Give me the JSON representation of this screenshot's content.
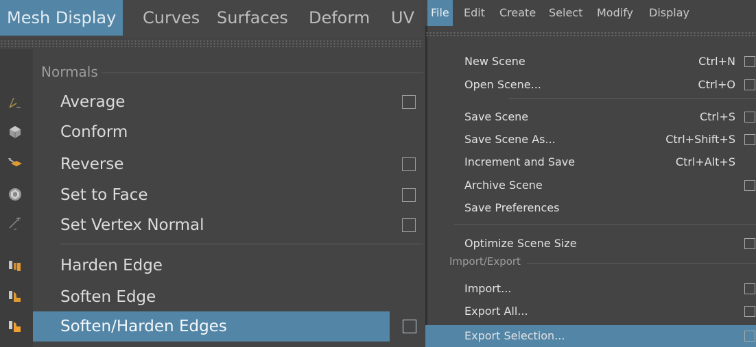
{
  "left_panel": {
    "menubar": [
      "Mesh Display",
      "Curves",
      "Surfaces",
      "Deform",
      "UV"
    ],
    "section_label": "Normals",
    "items": [
      {
        "label": "Average",
        "has_option": true,
        "icon": "average-normals-icon"
      },
      {
        "label": "Conform",
        "has_option": false,
        "icon": "conform-normals-icon"
      },
      {
        "label": "Reverse",
        "has_option": true,
        "icon": "reverse-normals-icon"
      },
      {
        "label": "Set to Face",
        "has_option": true,
        "icon": "set-to-face-icon"
      },
      {
        "label": "Set Vertex Normal",
        "has_option": true,
        "icon": "set-vertex-normal-icon"
      },
      {
        "label": "Harden Edge",
        "has_option": false,
        "icon": "harden-edge-icon"
      },
      {
        "label": "Soften Edge",
        "has_option": false,
        "icon": "soften-edge-icon"
      },
      {
        "label": "Soften/Harden Edges",
        "has_option": true,
        "icon": "soften-harden-edges-icon",
        "highlighted": true
      }
    ]
  },
  "right_panel": {
    "menubar": [
      "File",
      "Edit",
      "Create",
      "Select",
      "Modify",
      "Display"
    ],
    "items": [
      {
        "label": "New Scene",
        "shortcut": "Ctrl+N"
      },
      {
        "label": "Open Scene...",
        "shortcut": "Ctrl+O"
      },
      {
        "label": "Save Scene",
        "shortcut": "Ctrl+S"
      },
      {
        "label": "Save Scene As...",
        "shortcut": "Ctrl+Shift+S"
      },
      {
        "label": "Increment and Save",
        "shortcut": "Ctrl+Alt+S"
      },
      {
        "label": "Archive Scene",
        "shortcut": ""
      },
      {
        "label": "Save Preferences",
        "shortcut": ""
      },
      {
        "label": "Optimize Scene Size",
        "shortcut": ""
      },
      {
        "label": "Import...",
        "shortcut": ""
      },
      {
        "label": "Export All...",
        "shortcut": ""
      },
      {
        "label": "Export Selection...",
        "shortcut": ""
      }
    ],
    "section_label": "Import/Export"
  },
  "colors": {
    "background": "#444444",
    "highlight": "#5285a6",
    "text": "#dcdcdc",
    "section_text": "#9c9c9c"
  }
}
